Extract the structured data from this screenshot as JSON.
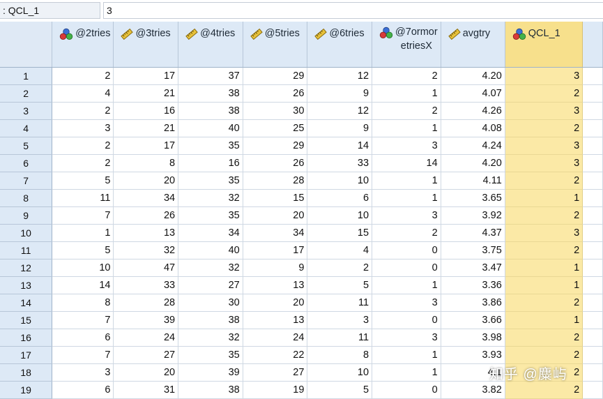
{
  "cell_editor": {
    "reference": ": QCL_1",
    "value": "3"
  },
  "columns": [
    {
      "label": "@2tries",
      "icon": "nominal-icon"
    },
    {
      "label": "@3tries",
      "icon": "scale-icon"
    },
    {
      "label": "@4tries",
      "icon": "scale-icon"
    },
    {
      "label": "@5tries",
      "icon": "scale-icon"
    },
    {
      "label": "@6tries",
      "icon": "scale-icon"
    },
    {
      "label": "@7ormoretriesX",
      "line1": "@7ormor",
      "line2": "etriesX",
      "icon": "nominal-icon"
    },
    {
      "label": "avgtry",
      "icon": "scale-icon"
    },
    {
      "label": "QCL_1",
      "icon": "nominal-icon"
    }
  ],
  "selected_column": "QCL_1",
  "rows": [
    {
      "n": "1",
      "cells": [
        "2",
        "17",
        "37",
        "29",
        "12",
        "2",
        "4.20",
        "3"
      ]
    },
    {
      "n": "2",
      "cells": [
        "4",
        "21",
        "38",
        "26",
        "9",
        "1",
        "4.07",
        "2"
      ]
    },
    {
      "n": "3",
      "cells": [
        "2",
        "16",
        "38",
        "30",
        "12",
        "2",
        "4.26",
        "3"
      ]
    },
    {
      "n": "4",
      "cells": [
        "3",
        "21",
        "40",
        "25",
        "9",
        "1",
        "4.08",
        "2"
      ]
    },
    {
      "n": "5",
      "cells": [
        "2",
        "17",
        "35",
        "29",
        "14",
        "3",
        "4.24",
        "3"
      ]
    },
    {
      "n": "6",
      "cells": [
        "2",
        "8",
        "16",
        "26",
        "33",
        "14",
        "4.20",
        "3"
      ]
    },
    {
      "n": "7",
      "cells": [
        "5",
        "20",
        "35",
        "28",
        "10",
        "1",
        "4.11",
        "2"
      ]
    },
    {
      "n": "8",
      "cells": [
        "11",
        "34",
        "32",
        "15",
        "6",
        "1",
        "3.65",
        "1"
      ]
    },
    {
      "n": "9",
      "cells": [
        "7",
        "26",
        "35",
        "20",
        "10",
        "3",
        "3.92",
        "2"
      ]
    },
    {
      "n": "10",
      "cells": [
        "1",
        "13",
        "34",
        "34",
        "15",
        "2",
        "4.37",
        "3"
      ]
    },
    {
      "n": "11",
      "cells": [
        "5",
        "32",
        "40",
        "17",
        "4",
        "0",
        "3.75",
        "2"
      ]
    },
    {
      "n": "12",
      "cells": [
        "10",
        "47",
        "32",
        "9",
        "2",
        "0",
        "3.47",
        "1"
      ]
    },
    {
      "n": "13",
      "cells": [
        "14",
        "33",
        "27",
        "13",
        "5",
        "1",
        "3.36",
        "1"
      ]
    },
    {
      "n": "14",
      "cells": [
        "8",
        "28",
        "30",
        "20",
        "11",
        "3",
        "3.86",
        "2"
      ]
    },
    {
      "n": "15",
      "cells": [
        "7",
        "39",
        "38",
        "13",
        "3",
        "0",
        "3.66",
        "1"
      ]
    },
    {
      "n": "16",
      "cells": [
        "6",
        "24",
        "32",
        "24",
        "11",
        "3",
        "3.98",
        "2"
      ]
    },
    {
      "n": "17",
      "cells": [
        "7",
        "27",
        "35",
        "22",
        "8",
        "1",
        "3.93",
        "2"
      ]
    },
    {
      "n": "18",
      "cells": [
        "3",
        "20",
        "39",
        "27",
        "10",
        "1",
        "4.1",
        "2"
      ]
    },
    {
      "n": "19",
      "cells": [
        "6",
        "31",
        "38",
        "19",
        "5",
        "0",
        "3.82",
        "2"
      ]
    }
  ],
  "watermark": "知乎 @麋屿",
  "colors": {
    "header_bg": "#dde9f6",
    "selected_header": "#f7e08c",
    "selected_cell": "#fbe9a6"
  }
}
